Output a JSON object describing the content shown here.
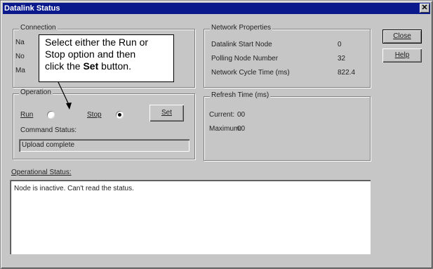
{
  "window": {
    "title": "Datalink Status",
    "close_glyph": "✕"
  },
  "connection": {
    "legend": "Connection",
    "row1": "Na",
    "row2": "No",
    "row3": "Ma"
  },
  "callout": {
    "line1": "Select either the Run or",
    "line2": "Stop option and then",
    "line3_prefix": "click the ",
    "line3_bold": "Set",
    "line3_suffix": " button."
  },
  "network_properties": {
    "legend": "Network Properties",
    "rows": [
      {
        "label": "Datalink Start Node",
        "value": "0"
      },
      {
        "label": "Polling Node Number",
        "value": "32"
      },
      {
        "label": "Network Cycle Time (ms)",
        "value": "822.4"
      }
    ]
  },
  "operation": {
    "legend": "Operation",
    "run_label": "Run",
    "run_selected": false,
    "stop_label": "Stop",
    "stop_selected": true,
    "set_label": "Set",
    "command_status_label": "Command Status:",
    "command_status_value": "Upload complete"
  },
  "refresh_time": {
    "legend": "Refresh Time (ms)",
    "current_label": "Current:",
    "current_value": "00",
    "maximum_label": "Maximum:",
    "maximum_value": "00"
  },
  "operational_status": {
    "label": "Operational Status:",
    "text": "Node is inactive. Can't read the status."
  },
  "buttons": {
    "close": "Close",
    "help": "Help"
  },
  "colors": {
    "titlebar": "#0a1a8c",
    "face": "#c6c6c6"
  }
}
